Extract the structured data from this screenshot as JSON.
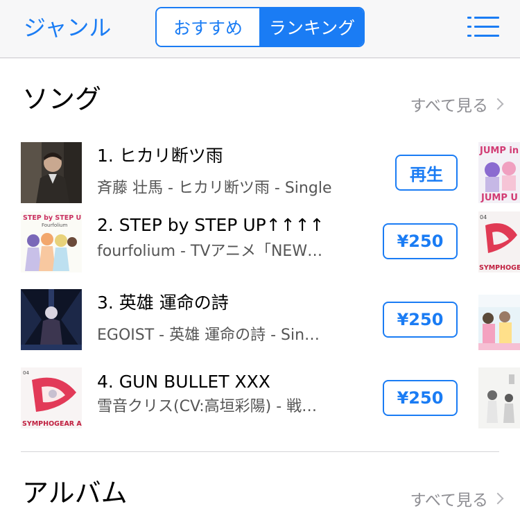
{
  "nav": {
    "genre_label": "ジャンル",
    "segments": [
      "おすすめ",
      "ランキング"
    ],
    "active_segment": 1
  },
  "songs_section": {
    "title": "ソング",
    "see_all": "すべて見る"
  },
  "songs": [
    {
      "title": "1. ヒカリ断ツ雨",
      "subtitle": "斉藤 壮馬 - ヒカリ断ツ雨 - Single",
      "action": "再生"
    },
    {
      "title": "2. STEP by STEP UP↑↑↑↑",
      "subtitle": "fourfolium - TVアニメ「NEW…",
      "action": "¥250"
    },
    {
      "title": "3. 英雄 運命の詩",
      "subtitle": "EGOIST - 英雄 運命の詩 - Sin…",
      "action": "¥250"
    },
    {
      "title": "4. GUN BULLET XXX",
      "subtitle": "雪音クリス(CV:高垣彩陽) - 戦…",
      "action": "¥250"
    }
  ],
  "artwork_text": {
    "step_by_step": "STEP by STEP UP",
    "step_artist": "Fourfolium",
    "symphogear": "SYMPHOGEAR AXZ",
    "jump": "JUMP in",
    "jump2": "JUMP U",
    "num04": "04"
  },
  "albums_section": {
    "title": "アルバム",
    "see_all": "すべて見る"
  },
  "colors": {
    "accent": "#1a7cf4",
    "navbar_bg": "#f7f7f8",
    "secondary_text": "#555555"
  }
}
